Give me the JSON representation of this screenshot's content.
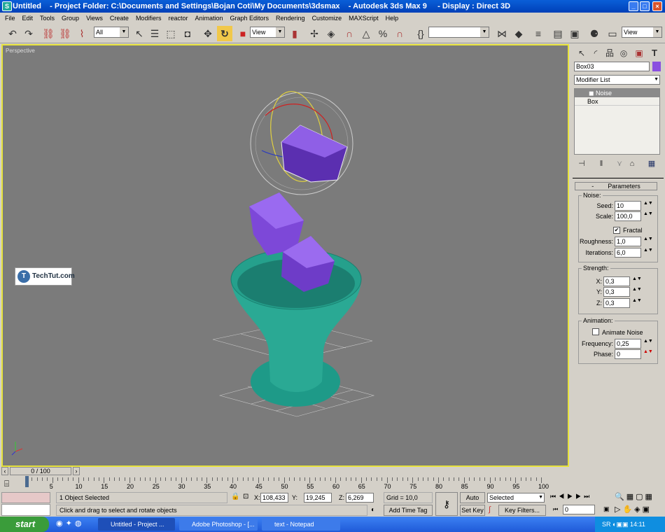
{
  "title": {
    "text": "Untitled    - Project Folder: C:\\Documents and Settings\\Bojan Coti\\My Documents\\3dsmax    - Autodesk 3ds Max 9     - Display : Direct 3D"
  },
  "menu": [
    "File",
    "Edit",
    "Tools",
    "Group",
    "Views",
    "Create",
    "Modifiers",
    "reactor",
    "Animation",
    "Graph Editors",
    "Rendering",
    "Customize",
    "MAXScript",
    "Help"
  ],
  "toolbar": {
    "selection_filter": "All",
    "ref_coord": "View",
    "view_right": "View",
    "active_tool": "select-and-rotate"
  },
  "viewport": {
    "label": "Perspective",
    "watermark": "TechTut.com",
    "bg": "#7b7b7b",
    "border": "#e6e23c"
  },
  "panel": {
    "object_name": "Box03",
    "object_color": "#8a4fe0",
    "modifier_list": "Modifier List",
    "stack": [
      "Noise",
      "Box"
    ],
    "rollout": "Parameters",
    "noise": {
      "label": "Noise:",
      "seed_label": "Seed:",
      "seed": "10",
      "scale_label": "Scale:",
      "scale": "100,0",
      "fractal_label": "Fractal",
      "fractal": true,
      "roughness_label": "Roughness:",
      "roughness": "1,0",
      "iterations_label": "Iterations:",
      "iterations": "6,0"
    },
    "strength": {
      "label": "Strength:",
      "x_label": "X:",
      "x": "0,3",
      "y_label": "Y:",
      "y": "0,3",
      "z_label": "Z:",
      "z": "0,3"
    },
    "animation": {
      "label": "Animation:",
      "animate_label": "Animate Noise",
      "animate": false,
      "frequency_label": "Frequency:",
      "frequency": "0,25",
      "phase_label": "Phase:",
      "phase": "0"
    }
  },
  "timeline": {
    "slider": "0 / 100",
    "ticks": [
      "5",
      "10",
      "15",
      "20",
      "25",
      "30",
      "35",
      "40",
      "45",
      "50",
      "55",
      "60",
      "65",
      "70",
      "75",
      "80",
      "85",
      "90",
      "95",
      "100"
    ]
  },
  "status": {
    "selected": "1 Object Selected",
    "prompt": "Click and drag to select and rotate objects",
    "x_label": "X:",
    "x": "108,433",
    "y_label": "Y:",
    "y": "19,245",
    "z_label": "Z:",
    "z": "6,269",
    "grid": "Grid = 10,0",
    "add_time_tag": "Add Time Tag",
    "auto_key": "Auto Key",
    "set_key": "Set Key",
    "key_mode": "Selected",
    "key_filters": "Key Filters...",
    "frame": "0"
  },
  "taskbar": {
    "start": "start",
    "tasks": [
      "Untitled    - Project ...",
      "Adobe Photoshop - [...",
      "text - Notepad"
    ],
    "lang": "SR",
    "clock": "14:11"
  }
}
